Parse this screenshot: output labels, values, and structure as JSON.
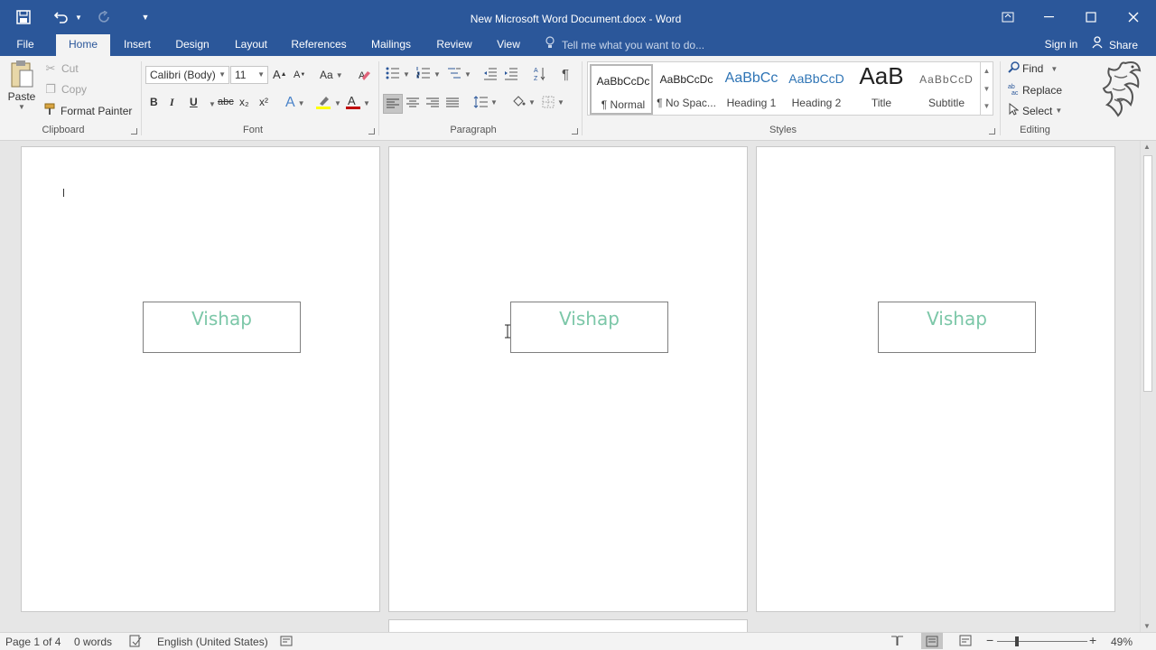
{
  "window": {
    "title": "New Microsoft Word Document.docx - Word",
    "sign_in": "Sign in",
    "share": "Share"
  },
  "tabs": [
    "File",
    "Home",
    "Insert",
    "Design",
    "Layout",
    "References",
    "Mailings",
    "Review",
    "View"
  ],
  "tell_me": "Tell me what you want to do...",
  "clipboard": {
    "paste": "Paste",
    "cut": "Cut",
    "copy": "Copy",
    "format_painter": "Format Painter",
    "label": "Clipboard"
  },
  "font": {
    "name": "Calibri (Body)",
    "size": "11",
    "label": "Font",
    "change_case": "Aa",
    "bold": "B",
    "italic": "I",
    "underline": "U",
    "strike": "abc",
    "subscript": "x₂",
    "superscript": "x²"
  },
  "paragraph": {
    "label": "Paragraph"
  },
  "styles": {
    "label": "Styles",
    "items": [
      {
        "preview": "AaBbCcDc",
        "name": "¶ Normal"
      },
      {
        "preview": "AaBbCcDc",
        "name": "¶ No Spac..."
      },
      {
        "preview": "AaBbCc",
        "name": "Heading 1"
      },
      {
        "preview": "AaBbCcD",
        "name": "Heading 2"
      },
      {
        "preview": "AaB",
        "name": "Title"
      },
      {
        "preview": "AaBbCcD",
        "name": "Subtitle"
      }
    ]
  },
  "editing": {
    "find": "Find",
    "replace": "Replace",
    "select": "Select",
    "label": "Editing"
  },
  "document": {
    "textbox_text": "Vishap"
  },
  "status": {
    "page": "Page 1 of 4",
    "words": "0 words",
    "language": "English (United States)",
    "zoom": "49%"
  },
  "colors": {
    "brand": "#2b579a",
    "textbox_text": "#7cc7a8",
    "highlight": "#ffff00",
    "font_color": "#c00000"
  }
}
